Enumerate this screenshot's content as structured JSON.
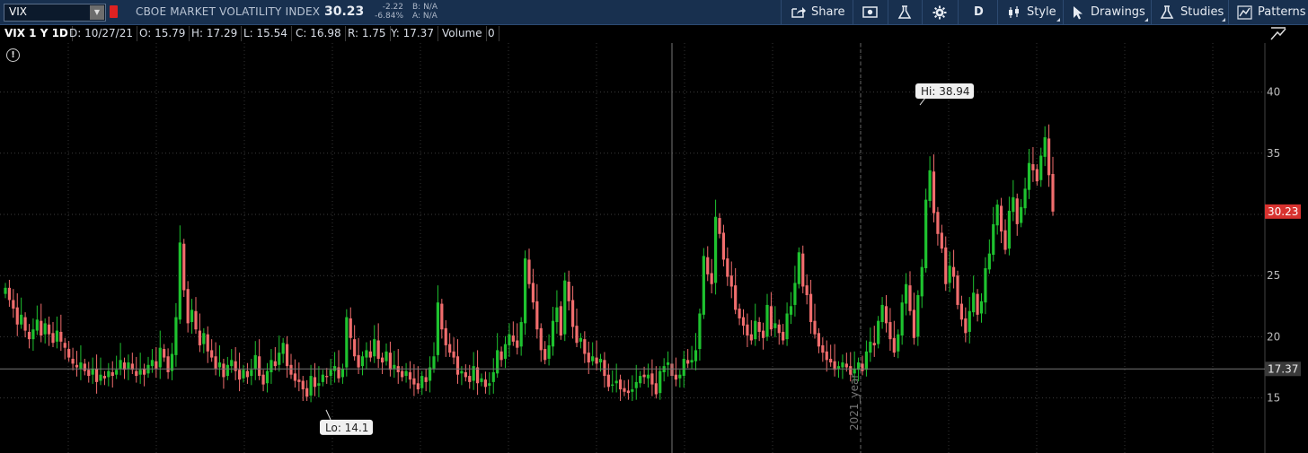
{
  "toolbar": {
    "symbol": "VIX",
    "name": "CBOE MARKET VOLATILITY INDEX",
    "last": "30.23",
    "change": "-2.22",
    "change_pct": "-6.84%",
    "bid": "B: N/A",
    "ask": "A: N/A",
    "buttons": {
      "share": "Share",
      "period": "D",
      "style": "Style",
      "drawings": "Drawings",
      "studies": "Studies",
      "patterns": "Patterns"
    },
    "icons": [
      "share-icon",
      "snapshot-icon",
      "flask-icon",
      "gear-icon",
      "candle-icon",
      "cursor-icon",
      "studies-flask-icon",
      "patterns-icon"
    ]
  },
  "infobar": {
    "title": "VIX 1 Y 1D",
    "date": "D: 10/27/21",
    "open": "O: 15.79",
    "high": "H: 17.29",
    "low": "L: 15.54",
    "close": "C: 16.98",
    "range": "R: 1.75",
    "y": "Y: 17.37",
    "volume_label": "Volume",
    "volume_value": "0"
  },
  "chart_data": {
    "type": "candlestick",
    "period": "1 Y",
    "interval": "1D",
    "ylim": [
      10.5,
      44
    ],
    "y_ticks": [
      15,
      20,
      25,
      30,
      35,
      40
    ],
    "grid": true,
    "last_price_label": "30.23",
    "last_price": 30.23,
    "cursor_price_label": "17.37",
    "cursor_price": 17.37,
    "hi_label": "Hi: 38.94",
    "hi": 38.94,
    "lo_label": "Lo: 14.1",
    "lo": 14.1,
    "year_marker": "2021_year",
    "up_color": "#1ec22f",
    "down_color": "#f06d6d",
    "closes": [
      24,
      23,
      22.3,
      21,
      21.8,
      20.5,
      19.8,
      20.6,
      21.4,
      20.1,
      21.1,
      20.2,
      19.5,
      20.5,
      19.6,
      19.1,
      18.3,
      17.8,
      17.5,
      17.9,
      17.2,
      16.8,
      17.4,
      16.3,
      16.9,
      16.6,
      17.2,
      16.8,
      17.3,
      18.1,
      17.3,
      17.9,
      17.3,
      16.8,
      17.3,
      16.9,
      17.7,
      18.1,
      17.4,
      19.1,
      18.3,
      17.1,
      18.6,
      21.6,
      27.7,
      23.8,
      21.1,
      22.2,
      20.6,
      19.3,
      20.3,
      18.8,
      18.3,
      17.4,
      17.9,
      16.7,
      17.7,
      18.1,
      17.2,
      16.5,
      17.3,
      16.7,
      17.3,
      18.5,
      16.8,
      16.1,
      17.2,
      18.1,
      17.6,
      18.7,
      19.5,
      17.6,
      16.9,
      16.4,
      16.3,
      15.7,
      15.1,
      16.8,
      15.9,
      16.2,
      16.9,
      16.7,
      17.3,
      17.6,
      16.6,
      17.4,
      21.6,
      19.9,
      18.4,
      17.5,
      18.4,
      18.9,
      18.3,
      19.8,
      18.2,
      17.9,
      18.8,
      17.3,
      17.7,
      17.1,
      16.7,
      17.2,
      16.5,
      16.1,
      15.7,
      16.8,
      16.3,
      17.5,
      18.4,
      22.8,
      20.6,
      19.3,
      18.7,
      18.3,
      16.9,
      17.2,
      16.7,
      16.3,
      17.6,
      16.2,
      16.6,
      15.9,
      16.2,
      17.1,
      18.9,
      18.1,
      19.4,
      20.2,
      19.6,
      19.1,
      21.2,
      26.4,
      24.3,
      22.8,
      20.6,
      18.9,
      18.1,
      19.3,
      21.3,
      22.4,
      20.1,
      24.6,
      22.9,
      20.8,
      19.5,
      19.9,
      18.6,
      17.9,
      18.4,
      17.8,
      18.2,
      16.8,
      15.9,
      16.1,
      16.4,
      15.7,
      15.5,
      15.4,
      15.7,
      16.3,
      16.8,
      16.7,
      16.9,
      16.1,
      15.3,
      17.2,
      17.6,
      17.9,
      16.8,
      16.5,
      16.9,
      18.2,
      17.8,
      18.1,
      18.9,
      21.9,
      26.6,
      25.1,
      24.3,
      29.8,
      28.4,
      26.3,
      24.9,
      24.1,
      22.2,
      21.5,
      20.9,
      20.1,
      19.7,
      21.3,
      20.4,
      19.9,
      22.6,
      20.6,
      21.1,
      20.3,
      19.7,
      21.9,
      22.5,
      24.4,
      26.9,
      24.1,
      23.4,
      21.2,
      20.2,
      19.2,
      18.7,
      18.1,
      17.9,
      17.3,
      17.6,
      17.9,
      17.5,
      16.9,
      17.4,
      17.9,
      17.2,
      18.8,
      19.6,
      19.3,
      21.3,
      22.6,
      21.1,
      19.8,
      18.7,
      20.2,
      22.8,
      24.3,
      22.1,
      19.9,
      23.4,
      25.7,
      31.2,
      33.6,
      30.1,
      28.4,
      27.2,
      24.3,
      25.8,
      24.9,
      22.6,
      21.4,
      20.3,
      22.1,
      23.6,
      21.8,
      22.9,
      25.6,
      26.8,
      29.2,
      30.8,
      28.6,
      27.1,
      30.3,
      31.4,
      29.2,
      30.6,
      32.1,
      34.2,
      33.6,
      32.7,
      34.8,
      36.3,
      33.2,
      30.23
    ],
    "opens": [
      23.5,
      24,
      23,
      22.4,
      21,
      21.6,
      20.4,
      19.8,
      20.5,
      21.3,
      20.2,
      21,
      20.3,
      19.6,
      20.4,
      19.5,
      19,
      18.2,
      17.7,
      17.4,
      17.8,
      17.3,
      16.9,
      17.4,
      16.4,
      16.8,
      16.7,
      17.1,
      16.9,
      17.4,
      17.9,
      17.4,
      17.8,
      17.2,
      16.9,
      17.4,
      17,
      17.6,
      18,
      17.5,
      19,
      18.4,
      17.2,
      18.5,
      21.4,
      27.6,
      23.9,
      21.2,
      22.1,
      20.5,
      19.4,
      20.2,
      18.9,
      18.4,
      17.5,
      17.8,
      16.8,
      17.6,
      18,
      17.3,
      16.6,
      17.2,
      16.8,
      17.4,
      18.4,
      16.9,
      16.2,
      17.1,
      18,
      17.7,
      18.6,
      19.4,
      17.7,
      17,
      16.5,
      16.4,
      15.8,
      15.2,
      16.7,
      16,
      16.3,
      16.8,
      16.8,
      17.2,
      17.5,
      16.7,
      17.5,
      21.5,
      19.8,
      18.5,
      17.6,
      18.3,
      18.8,
      18.4,
      19.7,
      18.3,
      18,
      18.7,
      17.4,
      17.6,
      17.2,
      16.8,
      17.1,
      16.6,
      16.2,
      15.8,
      16.7,
      16.4,
      17.4,
      18.5,
      22.7,
      20.7,
      19.4,
      18.8,
      18.4,
      17,
      17.1,
      16.8,
      16.4,
      17.5,
      16.3,
      16.5,
      16,
      16.3,
      17,
      18.8,
      18.2,
      19.3,
      20.1,
      19.7,
      19.2,
      21.1,
      26.3,
      24.4,
      22.9,
      20.7,
      19,
      18.2,
      19.2,
      21.2,
      22.5,
      20.2,
      24.5,
      23,
      20.9,
      19.6,
      19.8,
      18.7,
      18,
      18.3,
      17.9,
      18.1,
      16.9,
      16,
      16.2,
      16.5,
      15.8,
      15.6,
      15.5,
      15.8,
      16.2,
      16.9,
      16.6,
      17,
      16.2,
      15.4,
      17.1,
      17.7,
      17.8,
      16.9,
      16.6,
      16.8,
      18.1,
      17.9,
      18,
      19,
      21.8,
      26.5,
      25.2,
      24.4,
      29.7,
      28.5,
      26.4,
      25,
      24.2,
      22.3,
      21.6,
      21,
      20.2,
      19.8,
      21.2,
      20.5,
      20,
      22.5,
      20.7,
      21,
      20.4,
      19.8,
      21.8,
      22.6,
      24.3,
      26.8,
      24.2,
      23.5,
      21.3,
      20.3,
      19.3,
      18.8,
      18.2,
      18,
      17.4,
      17.5,
      17.8,
      17.6,
      17,
      17.3,
      17.8,
      17.3,
      18.7,
      19.5,
      19.4,
      21.2,
      22.5,
      21.2,
      19.9,
      18.8,
      20.1,
      22.7,
      24.2,
      22.2,
      20,
      23.3,
      25.6,
      31.1,
      33.5,
      30.2,
      28.5,
      27.3,
      24.4,
      25.7,
      25,
      22.7,
      21.5,
      20.4,
      22,
      23.5,
      21.9,
      22.8,
      25.5,
      26.7,
      29.1,
      30.7,
      28.7,
      27.2,
      30.2,
      31.3,
      29.3,
      30.5,
      32,
      34.1,
      33.7,
      32.8,
      34.7,
      36.2,
      33.3
    ]
  }
}
